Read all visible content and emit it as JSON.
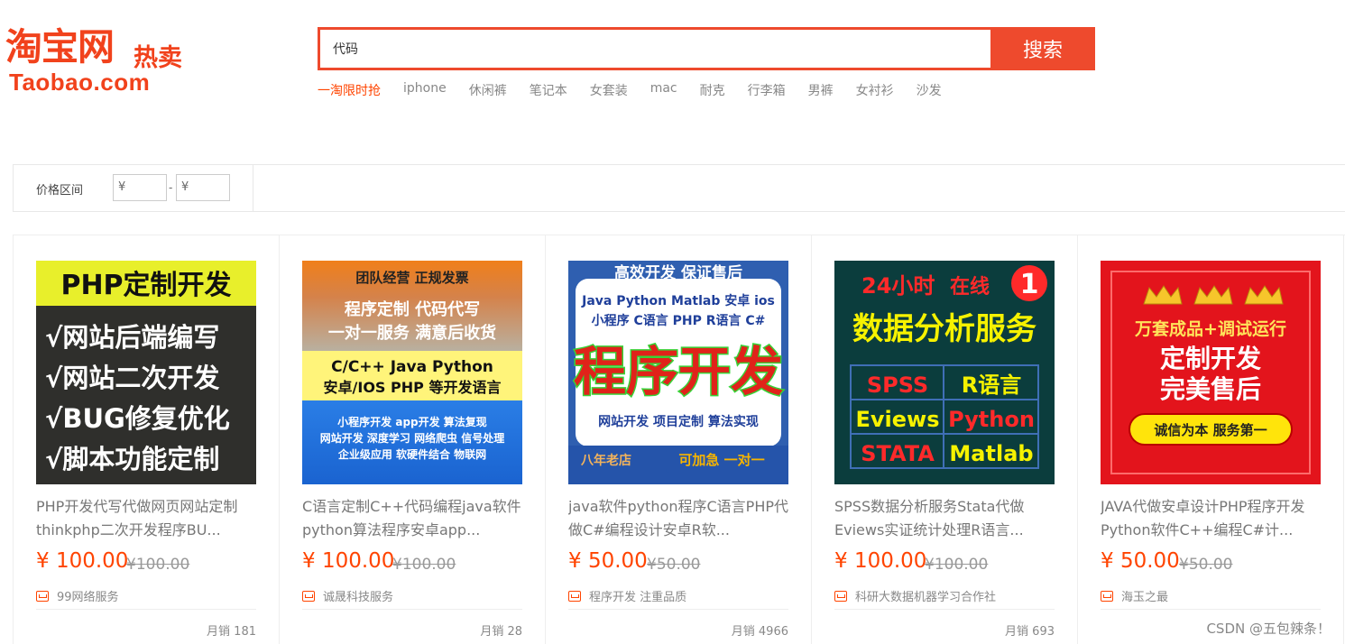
{
  "brand": {
    "logo_main": "淘宝网",
    "logo_sub": "热卖",
    "logo_en": "Taobao.com"
  },
  "search": {
    "value": "代码",
    "button_label": "搜索",
    "hot_words": [
      "一淘限时抢",
      "iphone",
      "休闲裤",
      "笔记本",
      "女套装",
      "mac",
      "耐克",
      "行李箱",
      "男裤",
      "女衬衫",
      "沙发"
    ]
  },
  "filter": {
    "label": "价格区间",
    "min_placeholder": "¥",
    "max_placeholder": "¥",
    "separator": "-"
  },
  "products": [
    {
      "title": "PHP开发代写代做网页网站定制thinkphp二次开发程序BU...",
      "price": "¥ 100.00",
      "old_price": "¥100.00",
      "shop": "99网络服务",
      "sales": "月销 181",
      "image_text": [
        "PHP定制开发",
        "√网站后端编写",
        "√网站二次开发",
        "√BUG修复优化",
        "√脚本功能定制"
      ]
    },
    {
      "title": "C语言定制C++代码编程java软件python算法程序安卓app...",
      "price": "¥ 100.00",
      "old_price": "¥100.00",
      "shop": "诚晟科技服务",
      "sales": "月销 28",
      "image_text": [
        "团队经营  正规发票",
        "程序定制   代码代写",
        "一对一服务  满意后收货",
        "C/C++   Java   Python",
        "安卓/IOS    PHP  等开发语言",
        "小程序开发 app开发 算法复现",
        "网站开发 深度学习 网络爬虫 信号处理",
        "企业级应用 软硬件结合 物联网"
      ]
    },
    {
      "title": "java软件python程序C语言PHP代做C#编程设计安卓R软...",
      "price": "¥ 50.00",
      "old_price": "¥50.00",
      "shop": "程序开发 注重品质",
      "sales": "月销 4966",
      "image_text": [
        "高效开发  保证售后",
        "Java Python Matlab 安卓 ios",
        "小程序 C语言 PHP R语言 C#",
        "程序开发",
        "网站开发  项目定制  算法实现",
        "八年老店",
        "可加急  一对一"
      ]
    },
    {
      "title": "SPSS数据分析服务Stata代做Eviews实证统计处理R语言...",
      "price": "¥ 100.00",
      "old_price": "¥100.00",
      "shop": "科研大数据机器学习合作社",
      "sales": "月销 693",
      "image_text": [
        "24小时",
        "在线",
        "1",
        "数据分析服务",
        "SPSS",
        "R语言",
        "Eviews",
        "Python",
        "STATA",
        "Matlab"
      ]
    },
    {
      "title": "JAVA代做安卓设计PHP程序开发Python软件C++编程C#计...",
      "price": "¥ 50.00",
      "old_price": "¥50.00",
      "shop": "海玉之最",
      "sales": "",
      "image_text": [
        "万套成品+调试运行",
        "定制开发",
        "完美售后",
        "诚信为本  服务第一"
      ]
    }
  ],
  "watermark": "CSDN @五包辣条！",
  "colors": {
    "accent": "#ee4a2d",
    "price": "#ff4400"
  }
}
